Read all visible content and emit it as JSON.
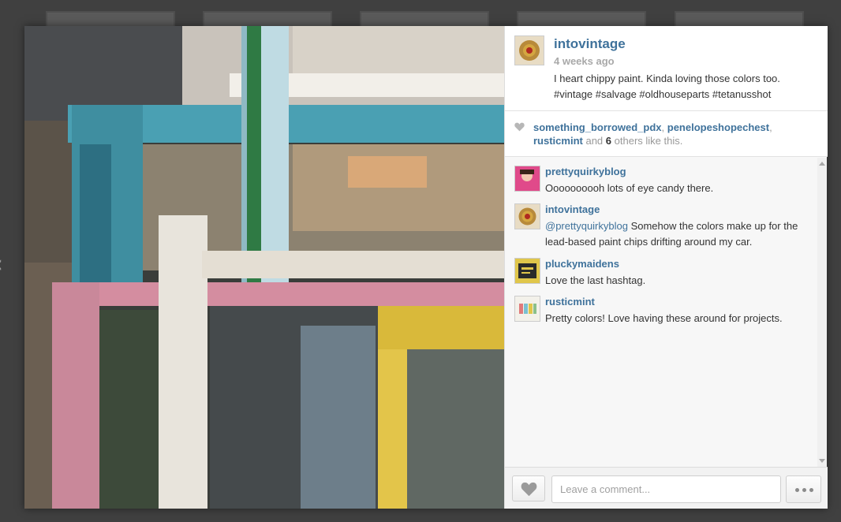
{
  "post": {
    "owner": "intovintage",
    "time_ago": "4 weeks ago",
    "caption": "I heart chippy paint. Kinda loving those colors too. #vintage #salvage #oldhouseparts #tetanusshot"
  },
  "likes": {
    "names": [
      "something_borrowed_pdx",
      "penelopeshopechest",
      "rusticmint"
    ],
    "and_text": "and",
    "others_count": "6",
    "others_suffix": "others like this."
  },
  "comments": [
    {
      "user": "prettyquirkyblog",
      "text": "Oooooooooh lots of eye candy there."
    },
    {
      "user": "intovintage",
      "mention": "@prettyquirkyblog",
      "text": " Somehow the colors make up for the lead-based paint chips drifting around my car."
    },
    {
      "user": "pluckymaidens",
      "text": "Love the last hashtag."
    },
    {
      "user": "rusticmint",
      "text": "Pretty colors! Love having these around for projects."
    }
  ],
  "footer": {
    "comment_placeholder": "Leave a comment..."
  },
  "icons": {
    "like": "heart-icon",
    "more": "ellipsis-icon",
    "prev": "chevron-left-icon"
  },
  "colors": {
    "username": "#3f729b",
    "backdrop": "#3c3c3c"
  }
}
